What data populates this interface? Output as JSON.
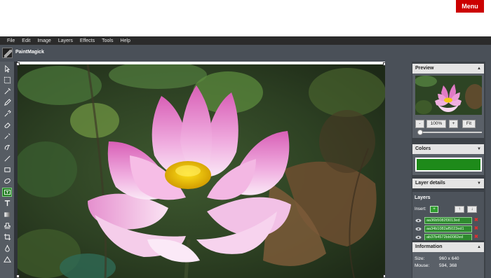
{
  "topbar": {
    "menu_label": "Menu"
  },
  "menubar": {
    "items": [
      "File",
      "Edit",
      "Image",
      "Layers",
      "Effects",
      "Tools",
      "Help"
    ]
  },
  "app": {
    "title": "PaintMagick"
  },
  "tools": [
    "pointer-icon",
    "marquee-select-icon",
    "magic-wand-icon",
    "pencil-icon",
    "eyedropper-icon",
    "eraser-icon",
    "magic-brush-icon",
    "smudge-icon",
    "line-icon",
    "rectangle-icon",
    "ellipse-icon",
    "text-frame-icon",
    "text-icon",
    "gradient-icon",
    "stamp-icon",
    "crop-icon",
    "water-drop-icon",
    "triangle-icon"
  ],
  "panels": {
    "preview": {
      "title": "Preview",
      "zoom_out": "-",
      "zoom_level": "100%",
      "zoom_in": "+",
      "fit": "Fit",
      "zoom_slider_fraction": 0.05
    },
    "colors": {
      "title": "Colors",
      "swatch": "#1e8a1a"
    },
    "layer_details": {
      "title": "Layer details"
    },
    "layers": {
      "title": "Layers",
      "insert_label": "Insert:",
      "insert_btn": "+",
      "move_up": "↑",
      "move_down": "↓",
      "rows": [
        {
          "name": "aa36b5082f3013ed"
        },
        {
          "name": "aa34b1082af5023ed1"
        },
        {
          "name": "ab37b4572bb0082ed"
        }
      ],
      "delete_glyph": "✖"
    },
    "information": {
      "title": "Information",
      "size_label": "Size:",
      "size_value": "960 x 640",
      "mouse_label": "Mouse:",
      "mouse_value": "594, 368"
    }
  },
  "colors": {
    "accent": "#cc0000",
    "selected_tool": "#1e7a1e",
    "layer_green": "#2f8a2f"
  }
}
